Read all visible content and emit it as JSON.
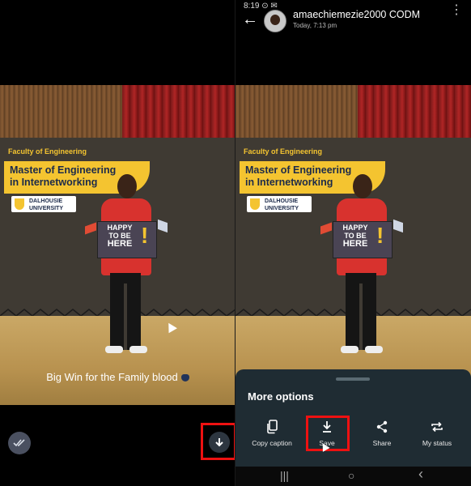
{
  "left_panel": {
    "caption": "Big Win for the Family blood",
    "caption_emoji": "blue-heart-icon",
    "seen_icon": "double-check-icon",
    "download_icon": "download-arrow-icon"
  },
  "photo": {
    "faculty_prefix": "Faculty of",
    "faculty_name": "Engineering",
    "banner_line1": "Master of Engineering",
    "banner_line2": "in Internetworking",
    "university_line1": "DALHOUSIE",
    "university_line2": "UNIVERSITY",
    "sign_line1": "HAPPY",
    "sign_line2": "TO BE",
    "sign_line3": "HERE",
    "sign_mark": "!"
  },
  "right_panel": {
    "status_bar_left": "8:19 ⊙ ✉",
    "header": {
      "back_icon": "arrow-left-icon",
      "username": "amaechiemezie2000 CODM",
      "time": "Today, 7:13 pm",
      "menu_icon": "more-vert-icon"
    },
    "sheet": {
      "title": "More options",
      "options": [
        {
          "label": "Copy caption",
          "icon": "copy-icon"
        },
        {
          "label": "Save",
          "icon": "download-icon"
        },
        {
          "label": "Share",
          "icon": "share-icon"
        },
        {
          "label": "My status",
          "icon": "repost-icon"
        }
      ]
    },
    "nav": {
      "recent": "|||",
      "home": "○",
      "back": "‹"
    }
  },
  "colors": {
    "highlight": "#ee1111",
    "sheet_bg": "#1f2c33",
    "banner_yellow": "#f4c430"
  }
}
